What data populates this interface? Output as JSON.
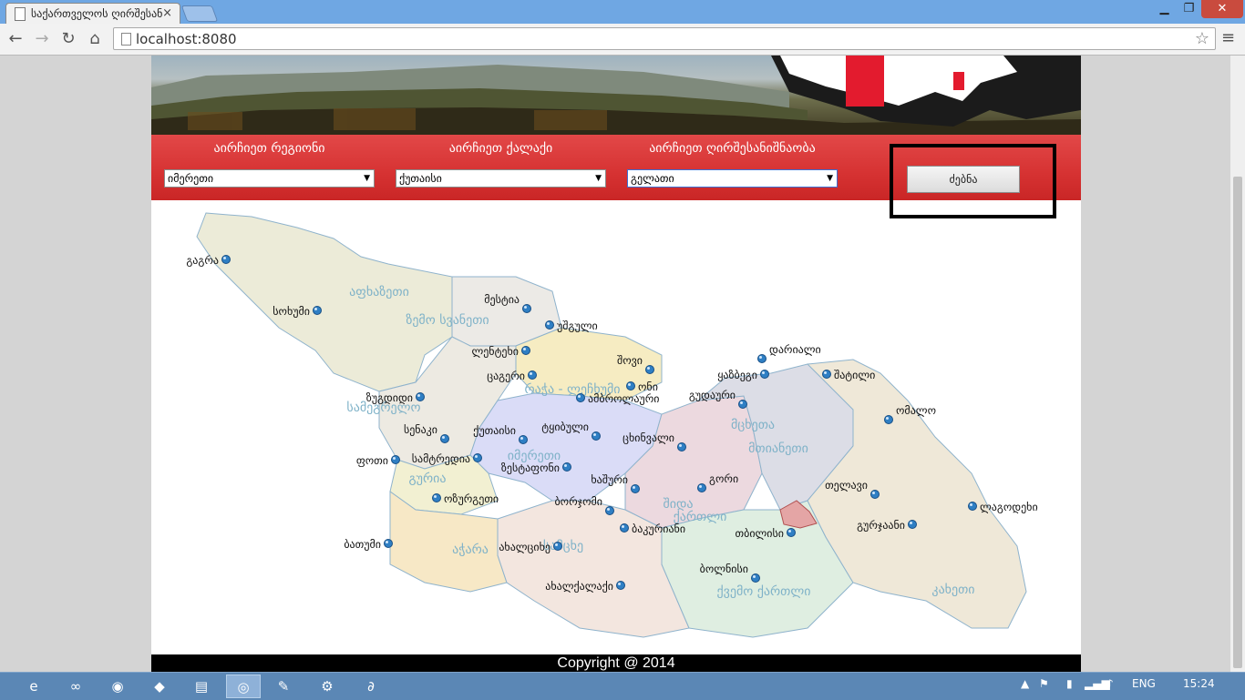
{
  "browser": {
    "tab_title": "საქართველოს ღირშესანიშნაობანი",
    "tab_close": "×",
    "url": "localhost:8080",
    "window_controls": {
      "minimize": "▁",
      "maximize": "❐",
      "close": "✕"
    }
  },
  "controls": {
    "region_label": "აირჩიეთ რეგიონი",
    "city_label": "აირჩიეთ ქალაქი",
    "sight_label": "აირჩიეთ ღირშესანიშნაობა",
    "region_value": "იმერეთი",
    "city_value": "ქუთაისი",
    "sight_value": "გელათი",
    "search_button": "ძებნა"
  },
  "map": {
    "regions": [
      {
        "name": "აფხაზეთი"
      },
      {
        "name": "ზემო სვანეთი"
      },
      {
        "name": "რაჭა - ლეჩხუმი"
      },
      {
        "name": "სამეგრელო"
      },
      {
        "name": "იმერეთი"
      },
      {
        "name": "გურია"
      },
      {
        "name": "აჭარა"
      },
      {
        "name": "სამცხე ჯავახეთი"
      },
      {
        "name": "შიდა ქართლი"
      },
      {
        "name": "მცხეთა მთიანეთი"
      },
      {
        "name": "ქვემო ქართლი"
      },
      {
        "name": "კახეთი"
      }
    ],
    "cities": [
      {
        "name": "გაგრა"
      },
      {
        "name": "სოხუმი"
      },
      {
        "name": "მესტია"
      },
      {
        "name": "უშგული"
      },
      {
        "name": "ლენტეხი"
      },
      {
        "name": "ცაგერი"
      },
      {
        "name": "შოვი"
      },
      {
        "name": "ონი"
      },
      {
        "name": "ამბროლაური"
      },
      {
        "name": "ზუგდიდი"
      },
      {
        "name": "სენაკი"
      },
      {
        "name": "ქუთაისი"
      },
      {
        "name": "ტყიბული"
      },
      {
        "name": "ფოთი"
      },
      {
        "name": "სამტრედია"
      },
      {
        "name": "ზესტაფონი"
      },
      {
        "name": "ოზურგეთი"
      },
      {
        "name": "ბორჯომი"
      },
      {
        "name": "ხაშური"
      },
      {
        "name": "ბაკურიანი"
      },
      {
        "name": "ბათუმი"
      },
      {
        "name": "ახალციხე"
      },
      {
        "name": "ახალქალაქი"
      },
      {
        "name": "გორი"
      },
      {
        "name": "ცხინვალი"
      },
      {
        "name": "გუდაური"
      },
      {
        "name": "ყაზბეგი"
      },
      {
        "name": "დარიალი"
      },
      {
        "name": "შატილი"
      },
      {
        "name": "ომალო"
      },
      {
        "name": "თელავი"
      },
      {
        "name": "გურჯაანი"
      },
      {
        "name": "ლაგოდეხი"
      },
      {
        "name": "თბილისი"
      },
      {
        "name": "ბოლნისი"
      }
    ]
  },
  "footer": {
    "copyright": "Copyright @ 2014"
  },
  "taskbar": {
    "language": "ENG",
    "clock": "15:24"
  }
}
